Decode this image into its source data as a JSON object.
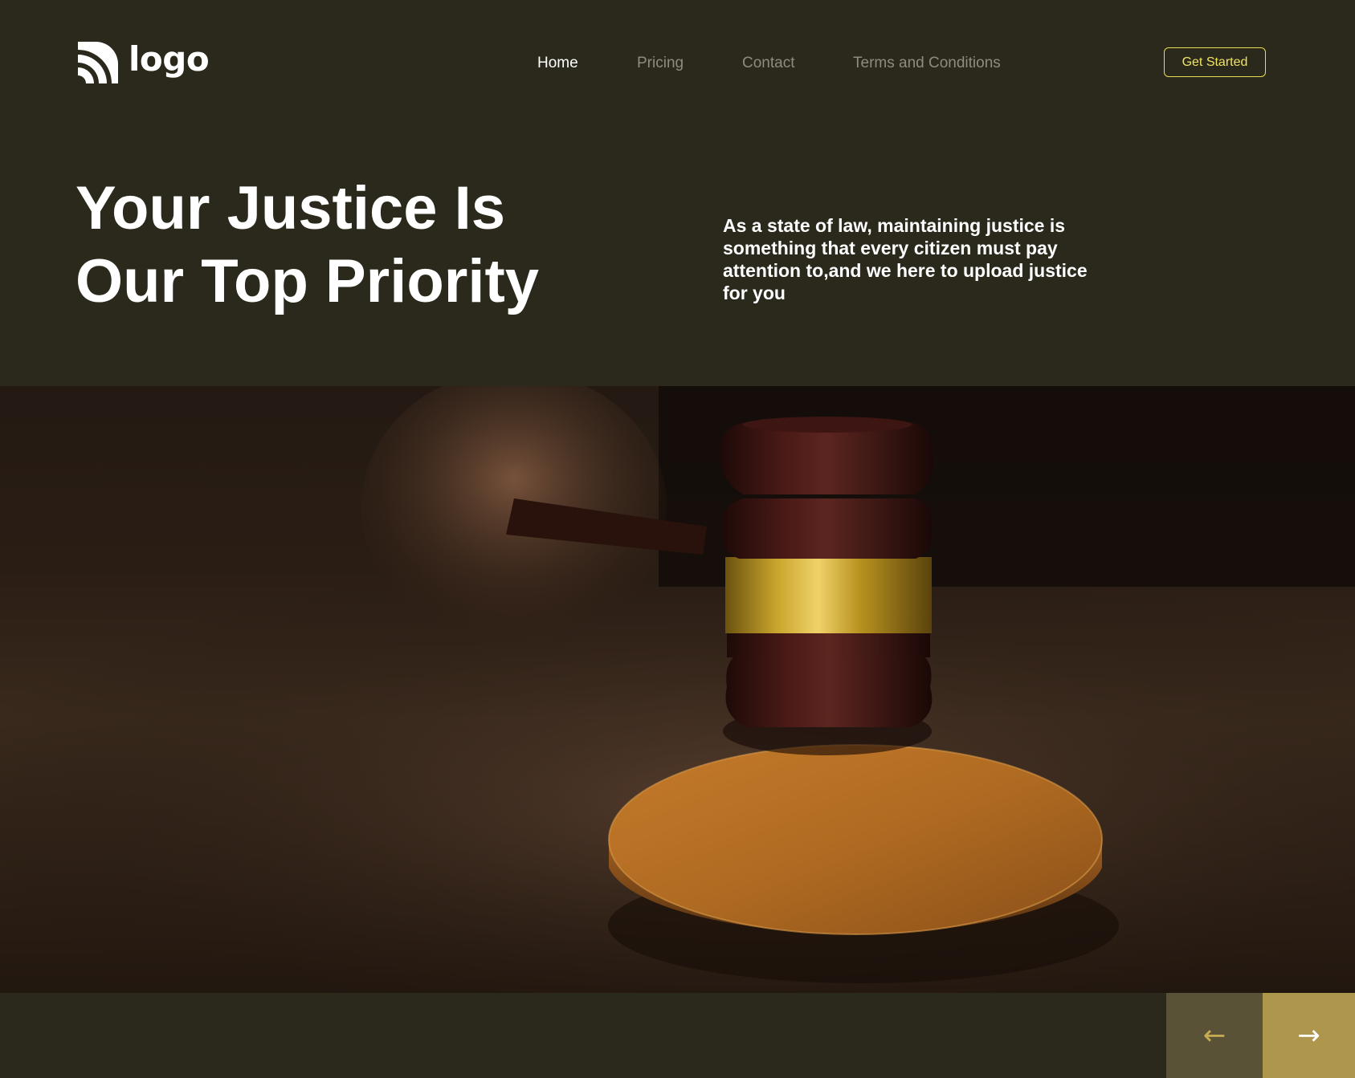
{
  "brand": {
    "logo_text": "logo",
    "logo_icon": "wifi-arcs-logo-icon"
  },
  "nav": {
    "items": [
      {
        "label": "Home",
        "active": true
      },
      {
        "label": "Pricing",
        "active": false
      },
      {
        "label": "Contact",
        "active": false
      },
      {
        "label": "Terms and Conditions",
        "active": false
      }
    ],
    "cta_label": "Get Started"
  },
  "hero": {
    "title_line1": "Your Justice Is",
    "title_line2": "Our Top Priority",
    "description": "As a state of law, maintaining justice is something that every citizen must pay attention to,and we here to upload justice for you",
    "image": "judge-gavel-on-sound-block-photo"
  },
  "carousel": {
    "prev_icon": "arrow-left-icon",
    "prev_glyph": "←",
    "next_icon": "arrow-right-icon",
    "next_glyph": "→"
  },
  "colors": {
    "background": "#2b291c",
    "accent_yellow": "#e7dc55",
    "nav_inactive": "#8e8c80",
    "prev_button": "#5a5236",
    "next_button": "#ae964c"
  }
}
